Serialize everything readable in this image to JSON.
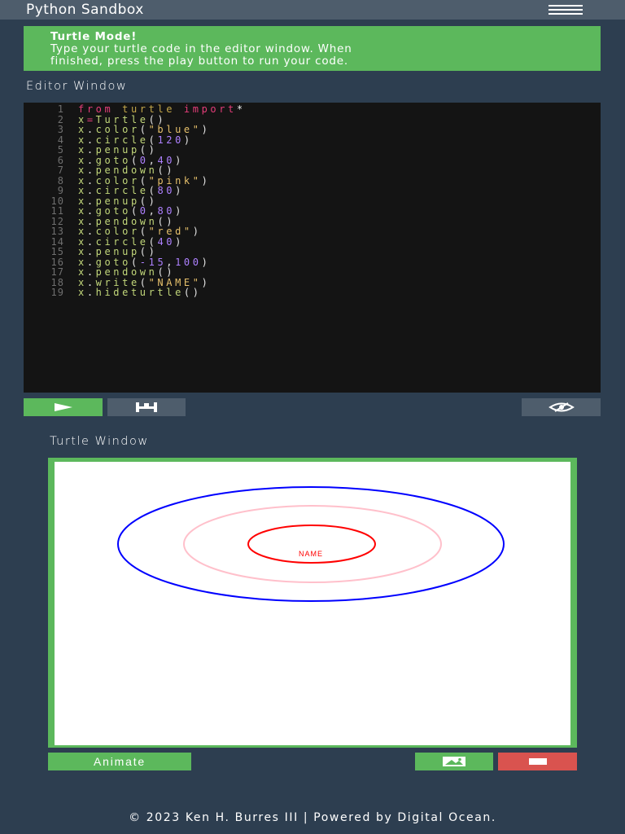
{
  "navbar": {
    "brand": "Python Sandbox",
    "menu_icon": "hamburger-menu-icon"
  },
  "alert": {
    "title": "Turtle Mode!",
    "message_line1": "Type your turtle code in the editor window. When",
    "message_line2": "finished, press the play button to run your code."
  },
  "editor": {
    "label": "Editor Window",
    "lines": [
      [
        {
          "t": "kw",
          "v": "from"
        },
        {
          "t": "p",
          "v": " "
        },
        {
          "t": "mod",
          "v": "turtle"
        },
        {
          "t": "p",
          "v": " "
        },
        {
          "t": "kw",
          "v": "import"
        },
        {
          "t": "p",
          "v": "*"
        }
      ],
      [
        {
          "t": "id",
          "v": "x"
        },
        {
          "t": "kw",
          "v": "="
        },
        {
          "t": "fn",
          "v": "Turtle"
        },
        {
          "t": "p",
          "v": "()"
        }
      ],
      [
        {
          "t": "id",
          "v": "x"
        },
        {
          "t": "p",
          "v": "."
        },
        {
          "t": "fn",
          "v": "color"
        },
        {
          "t": "p",
          "v": "("
        },
        {
          "t": "str",
          "v": "\"blue\""
        },
        {
          "t": "p",
          "v": ")"
        }
      ],
      [
        {
          "t": "id",
          "v": "x"
        },
        {
          "t": "p",
          "v": "."
        },
        {
          "t": "fn",
          "v": "circle"
        },
        {
          "t": "p",
          "v": "("
        },
        {
          "t": "num",
          "v": "120"
        },
        {
          "t": "p",
          "v": ")"
        }
      ],
      [
        {
          "t": "id",
          "v": "x"
        },
        {
          "t": "p",
          "v": "."
        },
        {
          "t": "fn",
          "v": "penup"
        },
        {
          "t": "p",
          "v": "()"
        }
      ],
      [
        {
          "t": "id",
          "v": "x"
        },
        {
          "t": "p",
          "v": "."
        },
        {
          "t": "fn",
          "v": "goto"
        },
        {
          "t": "p",
          "v": "("
        },
        {
          "t": "num",
          "v": "0"
        },
        {
          "t": "p",
          "v": ","
        },
        {
          "t": "num",
          "v": "40"
        },
        {
          "t": "p",
          "v": ")"
        }
      ],
      [
        {
          "t": "id",
          "v": "x"
        },
        {
          "t": "p",
          "v": "."
        },
        {
          "t": "fn",
          "v": "pendown"
        },
        {
          "t": "p",
          "v": "()"
        }
      ],
      [
        {
          "t": "id",
          "v": "x"
        },
        {
          "t": "p",
          "v": "."
        },
        {
          "t": "fn",
          "v": "color"
        },
        {
          "t": "p",
          "v": "("
        },
        {
          "t": "str",
          "v": "\"pink\""
        },
        {
          "t": "p",
          "v": ")"
        }
      ],
      [
        {
          "t": "id",
          "v": "x"
        },
        {
          "t": "p",
          "v": "."
        },
        {
          "t": "fn",
          "v": "circle"
        },
        {
          "t": "p",
          "v": "("
        },
        {
          "t": "num",
          "v": "80"
        },
        {
          "t": "p",
          "v": ")"
        }
      ],
      [
        {
          "t": "id",
          "v": "x"
        },
        {
          "t": "p",
          "v": "."
        },
        {
          "t": "fn",
          "v": "penup"
        },
        {
          "t": "p",
          "v": "()"
        }
      ],
      [
        {
          "t": "id",
          "v": "x"
        },
        {
          "t": "p",
          "v": "."
        },
        {
          "t": "fn",
          "v": "goto"
        },
        {
          "t": "p",
          "v": "("
        },
        {
          "t": "num",
          "v": "0"
        },
        {
          "t": "p",
          "v": ","
        },
        {
          "t": "num",
          "v": "80"
        },
        {
          "t": "p",
          "v": ")"
        }
      ],
      [
        {
          "t": "id",
          "v": "x"
        },
        {
          "t": "p",
          "v": "."
        },
        {
          "t": "fn",
          "v": "pendown"
        },
        {
          "t": "p",
          "v": "()"
        }
      ],
      [
        {
          "t": "id",
          "v": "x"
        },
        {
          "t": "p",
          "v": "."
        },
        {
          "t": "fn",
          "v": "color"
        },
        {
          "t": "p",
          "v": "("
        },
        {
          "t": "str",
          "v": "\"red\""
        },
        {
          "t": "p",
          "v": ")"
        }
      ],
      [
        {
          "t": "id",
          "v": "x"
        },
        {
          "t": "p",
          "v": "."
        },
        {
          "t": "fn",
          "v": "circle"
        },
        {
          "t": "p",
          "v": "("
        },
        {
          "t": "num",
          "v": "40"
        },
        {
          "t": "p",
          "v": ")"
        }
      ],
      [
        {
          "t": "id",
          "v": "x"
        },
        {
          "t": "p",
          "v": "."
        },
        {
          "t": "fn",
          "v": "penup"
        },
        {
          "t": "p",
          "v": "()"
        }
      ],
      [
        {
          "t": "id",
          "v": "x"
        },
        {
          "t": "p",
          "v": "."
        },
        {
          "t": "fn",
          "v": "goto"
        },
        {
          "t": "p",
          "v": "("
        },
        {
          "t": "num",
          "v": "-15"
        },
        {
          "t": "p",
          "v": ","
        },
        {
          "t": "num",
          "v": "100"
        },
        {
          "t": "p",
          "v": ")"
        }
      ],
      [
        {
          "t": "id",
          "v": "x"
        },
        {
          "t": "p",
          "v": "."
        },
        {
          "t": "fn",
          "v": "pendown"
        },
        {
          "t": "p",
          "v": "()"
        }
      ],
      [
        {
          "t": "id",
          "v": "x"
        },
        {
          "t": "p",
          "v": "."
        },
        {
          "t": "fn",
          "v": "write"
        },
        {
          "t": "p",
          "v": "("
        },
        {
          "t": "str",
          "v": "\"NAME\""
        },
        {
          "t": "p",
          "v": ")"
        }
      ],
      [
        {
          "t": "id",
          "v": "x"
        },
        {
          "t": "p",
          "v": "."
        },
        {
          "t": "fn",
          "v": "hideturtle"
        },
        {
          "t": "p",
          "v": "()"
        }
      ]
    ]
  },
  "toolbar": {
    "run_icon": "play-icon",
    "reset_icon": "clear-editor-icon",
    "toggle_icon": "eye-toggle-icon"
  },
  "turtle": {
    "label": "Turtle Window",
    "written_text": "NAME",
    "colors": {
      "blue": "#0000ff",
      "pink": "#ffc0cb",
      "red": "#ff0000"
    }
  },
  "controls": {
    "animate_label": "Animate",
    "save_image_icon": "image-icon",
    "clear_icon": "minus-icon"
  },
  "footer": {
    "text": "© 2023 Ken H. Burres III | Powered by Digital Ocean."
  }
}
